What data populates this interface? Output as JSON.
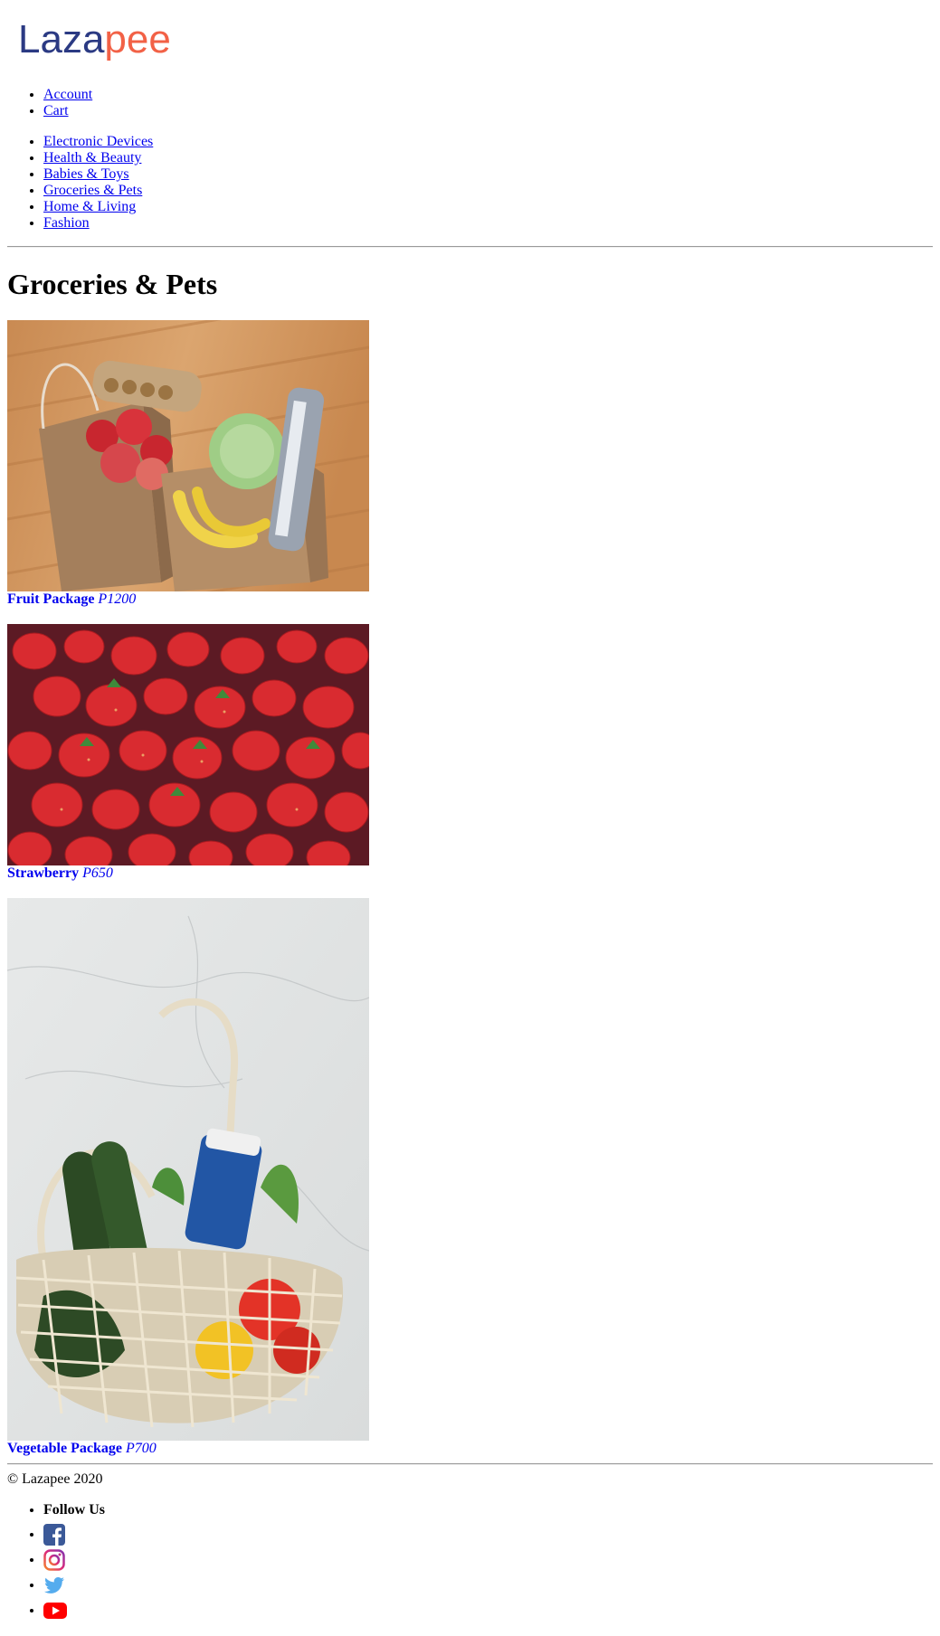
{
  "brand": {
    "name_part1": "Laza",
    "name_part2": "pee",
    "color_part1": "#2b3a83",
    "color_part2": "#f26146"
  },
  "account_nav": [
    {
      "label": "Account"
    },
    {
      "label": "Cart"
    }
  ],
  "category_nav": [
    {
      "label": "Electronic Devices"
    },
    {
      "label": "Health & Beauty"
    },
    {
      "label": "Babies & Toys"
    },
    {
      "label": "Groceries & Pets"
    },
    {
      "label": "Home & Living"
    },
    {
      "label": "Fashion"
    }
  ],
  "page_title": "Groceries & Pets",
  "products": [
    {
      "name": "Fruit Package",
      "price": "P1200",
      "image_icon": "grocery-bags-photo"
    },
    {
      "name": "Strawberry",
      "price": "P650",
      "image_icon": "strawberries-photo"
    },
    {
      "name": "Vegetable Package",
      "price": "P700",
      "image_icon": "vegetable-net-bag-photo"
    }
  ],
  "footer": {
    "copyright": "© Lazapee 2020",
    "follow_label": "Follow Us",
    "social": [
      {
        "icon": "facebook-icon",
        "color": "#3b5998"
      },
      {
        "icon": "instagram-icon",
        "color": "#c13584"
      },
      {
        "icon": "twitter-icon",
        "color": "#55acee"
      },
      {
        "icon": "youtube-icon",
        "color": "#ff0000"
      }
    ]
  }
}
